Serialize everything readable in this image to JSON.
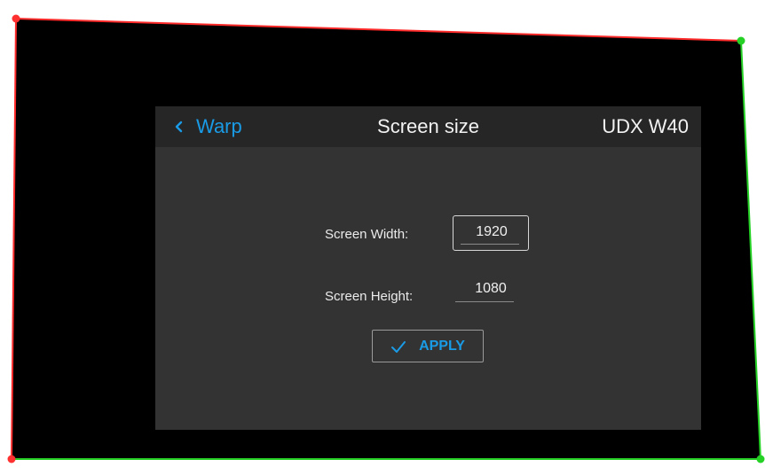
{
  "header": {
    "back_label": "Warp",
    "title": "Screen size",
    "model": "UDX W40",
    "back_icon": "chevron-left-icon"
  },
  "fields": {
    "width": {
      "label": "Screen Width:",
      "value": "1920"
    },
    "height": {
      "label": "Screen Height:",
      "value": "1080"
    }
  },
  "actions": {
    "apply_label": "APPLY",
    "apply_icon": "checkmark-icon"
  },
  "colors": {
    "background": "#000000",
    "panel": "#333333",
    "panel_header": "#262626",
    "accent": "#1a9be6",
    "warp_left_edge": "#ff2a2a",
    "warp_top_edge": "#ff2a2a",
    "warp_right_edge": "#25d125",
    "warp_bottom_edge": "#25d125"
  }
}
